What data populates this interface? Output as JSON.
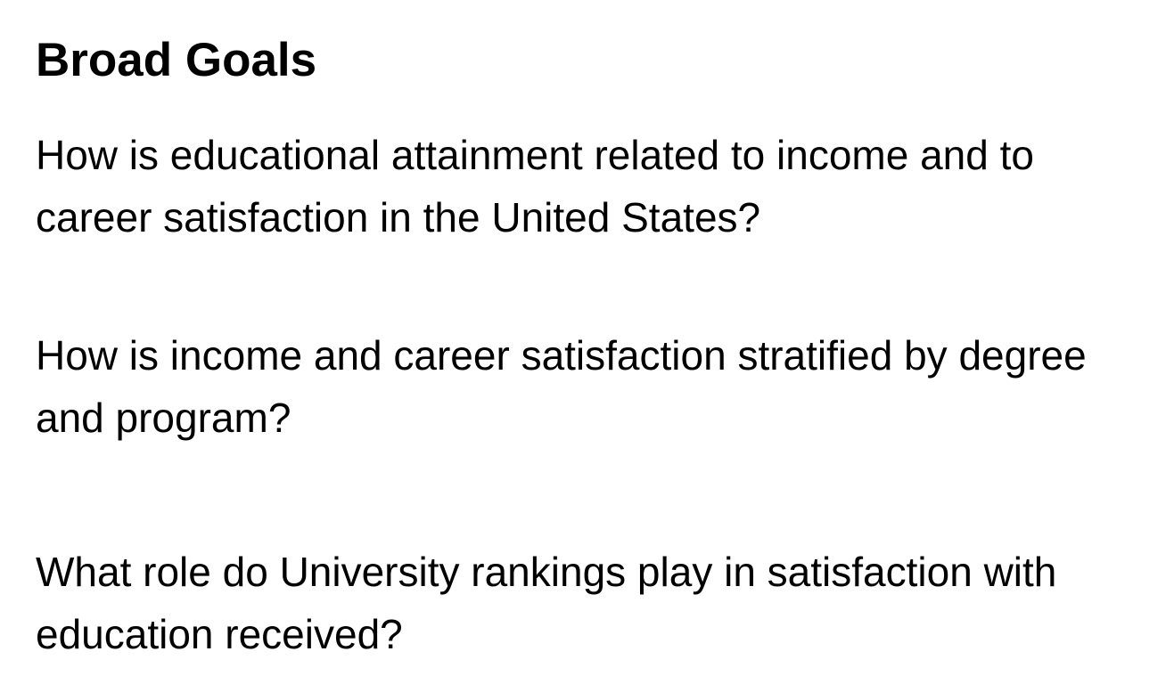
{
  "title": "Broad Goals",
  "goals": [
    "How is educational attainment related to income and to career satisfaction in the United States?",
    "How is income and career satisfaction stratified by degree and program?",
    "What role do University rankings play in satisfaction with education received?"
  ]
}
